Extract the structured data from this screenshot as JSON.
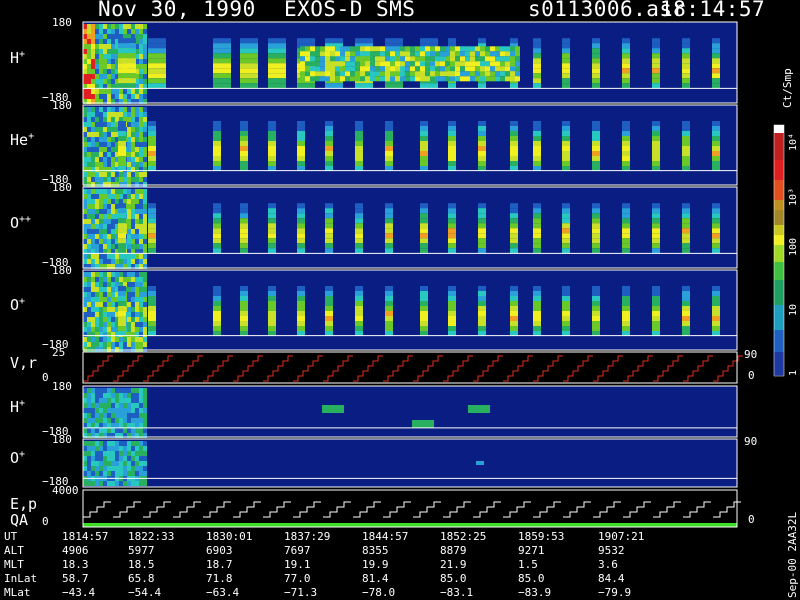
{
  "header": {
    "date": "Nov 30, 1990",
    "mission": "EXOS-D SMS",
    "file": "s0113006.asr",
    "time": "18:14:57"
  },
  "colors": {
    "background": "#000000",
    "panel_fill": "#0a1d82",
    "divider": "#ffffff",
    "cycle_trace": "#e03020",
    "qa_bar": "#3cdc28"
  },
  "panels": [
    {
      "id": "H+",
      "name": "H",
      "sup": "+",
      "ymax": "180",
      "ymin": "−180"
    },
    {
      "id": "He+",
      "name": "He",
      "sup": "+",
      "ymax": "180",
      "ymin": "−180"
    },
    {
      "id": "O++",
      "name": "O",
      "sup": "++",
      "ymax": "180",
      "ymin": "−180"
    },
    {
      "id": "O+",
      "name": "O",
      "sup": "+",
      "ymax": "180",
      "ymin": "−180"
    },
    {
      "id": "Vr",
      "name": "V,r",
      "sup": "",
      "ymax": "25",
      "ymin": "0",
      "right": "90",
      "right2": "0"
    },
    {
      "id": "H+2",
      "name": "H",
      "sup": "+",
      "ymax": "180",
      "ymin": "−180"
    },
    {
      "id": "O+2",
      "name": "O",
      "sup": "+",
      "ymax": "180",
      "ymin": "−180",
      "right": "90"
    },
    {
      "id": "Ep",
      "name": "E,p",
      "sup": "",
      "ymax": "4000",
      "ymin": "0",
      "name2": "QA",
      "right2": "0"
    }
  ],
  "colorbar": {
    "unit": "Ct/Smp",
    "labels": [
      "10⁴",
      "10³",
      "100",
      "10",
      "1"
    ]
  },
  "table": {
    "rows": [
      {
        "label": "UT",
        "values": [
          "1814:57",
          "1822:33",
          "1830:01",
          "1837:29",
          "1844:57",
          "1852:25",
          "1859:53",
          "1907:21"
        ]
      },
      {
        "label": "ALT",
        "values": [
          "4906",
          "5977",
          "6903",
          "7697",
          "8355",
          "8879",
          "9271",
          "9532"
        ]
      },
      {
        "label": "MLT",
        "values": [
          "18.3",
          "18.5",
          "18.7",
          "19.1",
          "19.9",
          "21.9",
          "1.5",
          "3.6"
        ]
      },
      {
        "label": "InLat",
        "values": [
          "58.7",
          "65.8",
          "71.8",
          "77.0",
          "81.4",
          "85.0",
          "85.0",
          "84.4"
        ]
      },
      {
        "label": "MLat",
        "values": [
          "−43.4",
          "−54.4",
          "−63.4",
          "−71.3",
          "−78.0",
          "−83.1",
          "−83.9",
          "−79.9"
        ]
      }
    ]
  },
  "footer_stamp": "Sep-00  2AA32L",
  "chart_data": [
    {
      "type": "heatmap",
      "title": "H+",
      "ylim": [
        -180,
        180
      ],
      "color_scale": "log",
      "x": [
        "1814:57",
        "1822:33",
        "1830:01",
        "1837:29",
        "1844:57",
        "1852:25",
        "1859:53",
        "1907:21"
      ]
    },
    {
      "type": "heatmap",
      "title": "He+",
      "ylim": [
        -180,
        180
      ],
      "color_scale": "log"
    },
    {
      "type": "heatmap",
      "title": "O++",
      "ylim": [
        -180,
        180
      ],
      "color_scale": "log"
    },
    {
      "type": "heatmap",
      "title": "O+",
      "ylim": [
        -180,
        180
      ],
      "color_scale": "log"
    },
    {
      "type": "line",
      "title": "V,r",
      "ylim": [
        0,
        25
      ],
      "y2lim": [
        0,
        90
      ]
    },
    {
      "type": "heatmap",
      "title": "H+",
      "ylim": [
        -180,
        180
      ],
      "color_scale": "log"
    },
    {
      "type": "heatmap",
      "title": "O+",
      "ylim": [
        -180,
        180
      ],
      "color_scale": "log",
      "y2lim": [
        0,
        90
      ]
    },
    {
      "type": "line",
      "title": "E,p / QA",
      "ylim": [
        0,
        4000
      ],
      "y2lim": [
        0,
        90
      ]
    }
  ]
}
